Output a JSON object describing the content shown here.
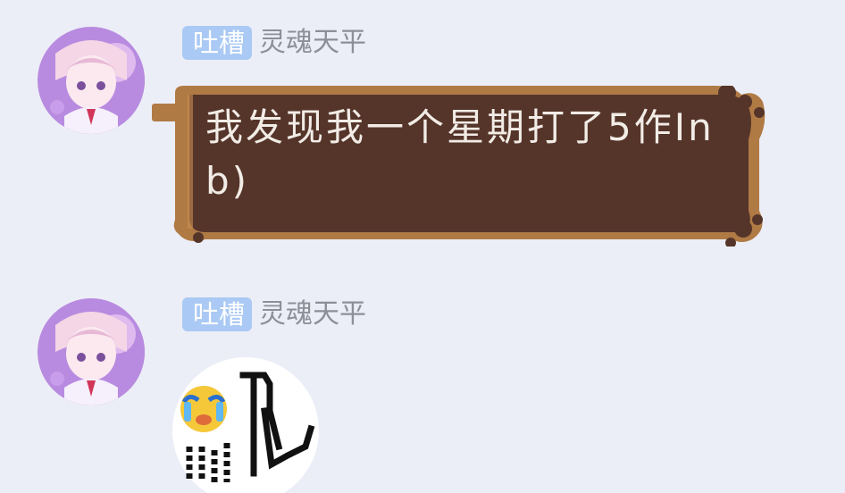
{
  "messages": [
    {
      "tag": "吐槽",
      "sender": "灵魂天平",
      "text": "我发现我一个星期打了5作Inb)"
    },
    {
      "tag": "吐槽",
      "sender": "灵魂天平",
      "sticker": "crying-emoji-sticker"
    }
  ],
  "colors": {
    "background": "#eceef7",
    "tag_bg": "#aac9f4",
    "bubble": "#55352a",
    "bubble_frame": "#b07a45"
  }
}
